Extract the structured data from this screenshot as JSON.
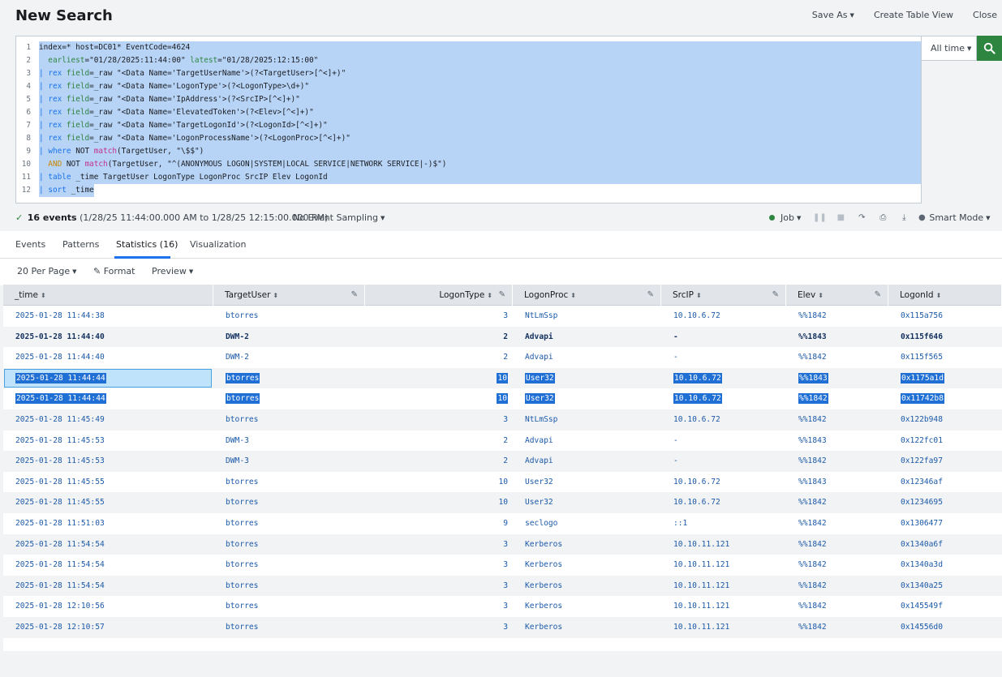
{
  "header": {
    "title": "New Search",
    "save_as": "Save As",
    "create_table_view": "Create Table View",
    "close": "Close"
  },
  "search": {
    "lines": [
      {
        "n": "1",
        "t": "index=* host=DC01* EventCode=4624"
      },
      {
        "n": "2",
        "t": "  earliest=\"01/28/2025:11:44:00\" latest=\"01/28/2025:12:15:00\""
      },
      {
        "n": "3",
        "t": "| rex field=_raw \"<Data Name='TargetUserName'>(?<TargetUser>[^<]+)\""
      },
      {
        "n": "4",
        "t": "| rex field=_raw \"<Data Name='LogonType'>(?<LogonType>\\d+)\""
      },
      {
        "n": "5",
        "t": "| rex field=_raw \"<Data Name='IpAddress'>(?<SrcIP>[^<]+)\""
      },
      {
        "n": "6",
        "t": "| rex field=_raw \"<Data Name='ElevatedToken'>(?<Elev>[^<]+)\""
      },
      {
        "n": "7",
        "t": "| rex field=_raw \"<Data Name='TargetLogonId'>(?<LogonId>[^<]+)\""
      },
      {
        "n": "8",
        "t": "| rex field=_raw \"<Data Name='LogonProcessName'>(?<LogonProc>[^<]+)\""
      },
      {
        "n": "9",
        "t": "| where NOT match(TargetUser, \"\\$$\")"
      },
      {
        "n": "10",
        "t": "  AND NOT match(TargetUser, \"^(ANONYMOUS LOGON|SYSTEM|LOCAL SERVICE|NETWORK SERVICE|-)$\")"
      },
      {
        "n": "11",
        "t": "| table _time TargetUser LogonType LogonProc SrcIP Elev LogonId"
      },
      {
        "n": "12",
        "t": "| sort _time"
      }
    ],
    "time_range": "All time"
  },
  "status": {
    "events_count": "16 events",
    "range": "(1/28/25 11:44:00.000 AM to 1/28/25 12:15:00.000 PM)",
    "sampling": "No Event Sampling",
    "job": "Job",
    "mode": "Smart Mode"
  },
  "tabs": [
    {
      "label": "Events"
    },
    {
      "label": "Patterns"
    },
    {
      "label": "Statistics (16)"
    },
    {
      "label": "Visualization"
    }
  ],
  "toolbar": {
    "per_page": "20 Per Page",
    "format": "Format",
    "preview": "Preview"
  },
  "table": {
    "columns": [
      "_time",
      "TargetUser",
      "LogonType",
      "LogonProc",
      "SrcIP",
      "Elev",
      "LogonId"
    ],
    "rows": [
      [
        "2025-01-28 11:44:38",
        "btorres",
        "3",
        "NtLmSsp",
        "10.10.6.72",
        "%%1842",
        "0x115a756"
      ],
      [
        "2025-01-28 11:44:40",
        "DWM-2",
        "2",
        "Advapi",
        "-",
        "%%1843",
        "0x115f646"
      ],
      [
        "2025-01-28 11:44:40",
        "DWM-2",
        "2",
        "Advapi",
        "-",
        "%%1842",
        "0x115f565"
      ],
      [
        "2025-01-28 11:44:44",
        "btorres",
        "10",
        "User32",
        "10.10.6.72",
        "%%1843",
        "0x1175a1d"
      ],
      [
        "2025-01-28 11:44:44",
        "btorres",
        "10",
        "User32",
        "10.10.6.72",
        "%%1842",
        "0x11742b8"
      ],
      [
        "2025-01-28 11:45:49",
        "btorres",
        "3",
        "NtLmSsp",
        "10.10.6.72",
        "%%1842",
        "0x122b948"
      ],
      [
        "2025-01-28 11:45:53",
        "DWM-3",
        "2",
        "Advapi",
        "-",
        "%%1843",
        "0x122fc01"
      ],
      [
        "2025-01-28 11:45:53",
        "DWM-3",
        "2",
        "Advapi",
        "-",
        "%%1842",
        "0x122fa97"
      ],
      [
        "2025-01-28 11:45:55",
        "btorres",
        "10",
        "User32",
        "10.10.6.72",
        "%%1843",
        "0x12346af"
      ],
      [
        "2025-01-28 11:45:55",
        "btorres",
        "10",
        "User32",
        "10.10.6.72",
        "%%1842",
        "0x1234695"
      ],
      [
        "2025-01-28 11:51:03",
        "btorres",
        "9",
        "seclogo",
        "::1",
        "%%1842",
        "0x1306477"
      ],
      [
        "2025-01-28 11:54:54",
        "btorres",
        "3",
        "Kerberos",
        "10.10.11.121",
        "%%1842",
        "0x1340a6f"
      ],
      [
        "2025-01-28 11:54:54",
        "btorres",
        "3",
        "Kerberos",
        "10.10.11.121",
        "%%1842",
        "0x1340a3d"
      ],
      [
        "2025-01-28 11:54:54",
        "btorres",
        "3",
        "Kerberos",
        "10.10.11.121",
        "%%1842",
        "0x1340a25"
      ],
      [
        "2025-01-28 12:10:56",
        "btorres",
        "3",
        "Kerberos",
        "10.10.11.121",
        "%%1842",
        "0x145549f"
      ],
      [
        "2025-01-28 12:10:57",
        "btorres",
        "3",
        "Kerberos",
        "10.10.11.121",
        "%%1842",
        "0x14556d0"
      ]
    ]
  },
  "colors": {
    "accent": "#1a73e8",
    "search_button": "#2e8540",
    "selection": "#b7d4f7",
    "row_highlight": "#1f6fd4"
  }
}
